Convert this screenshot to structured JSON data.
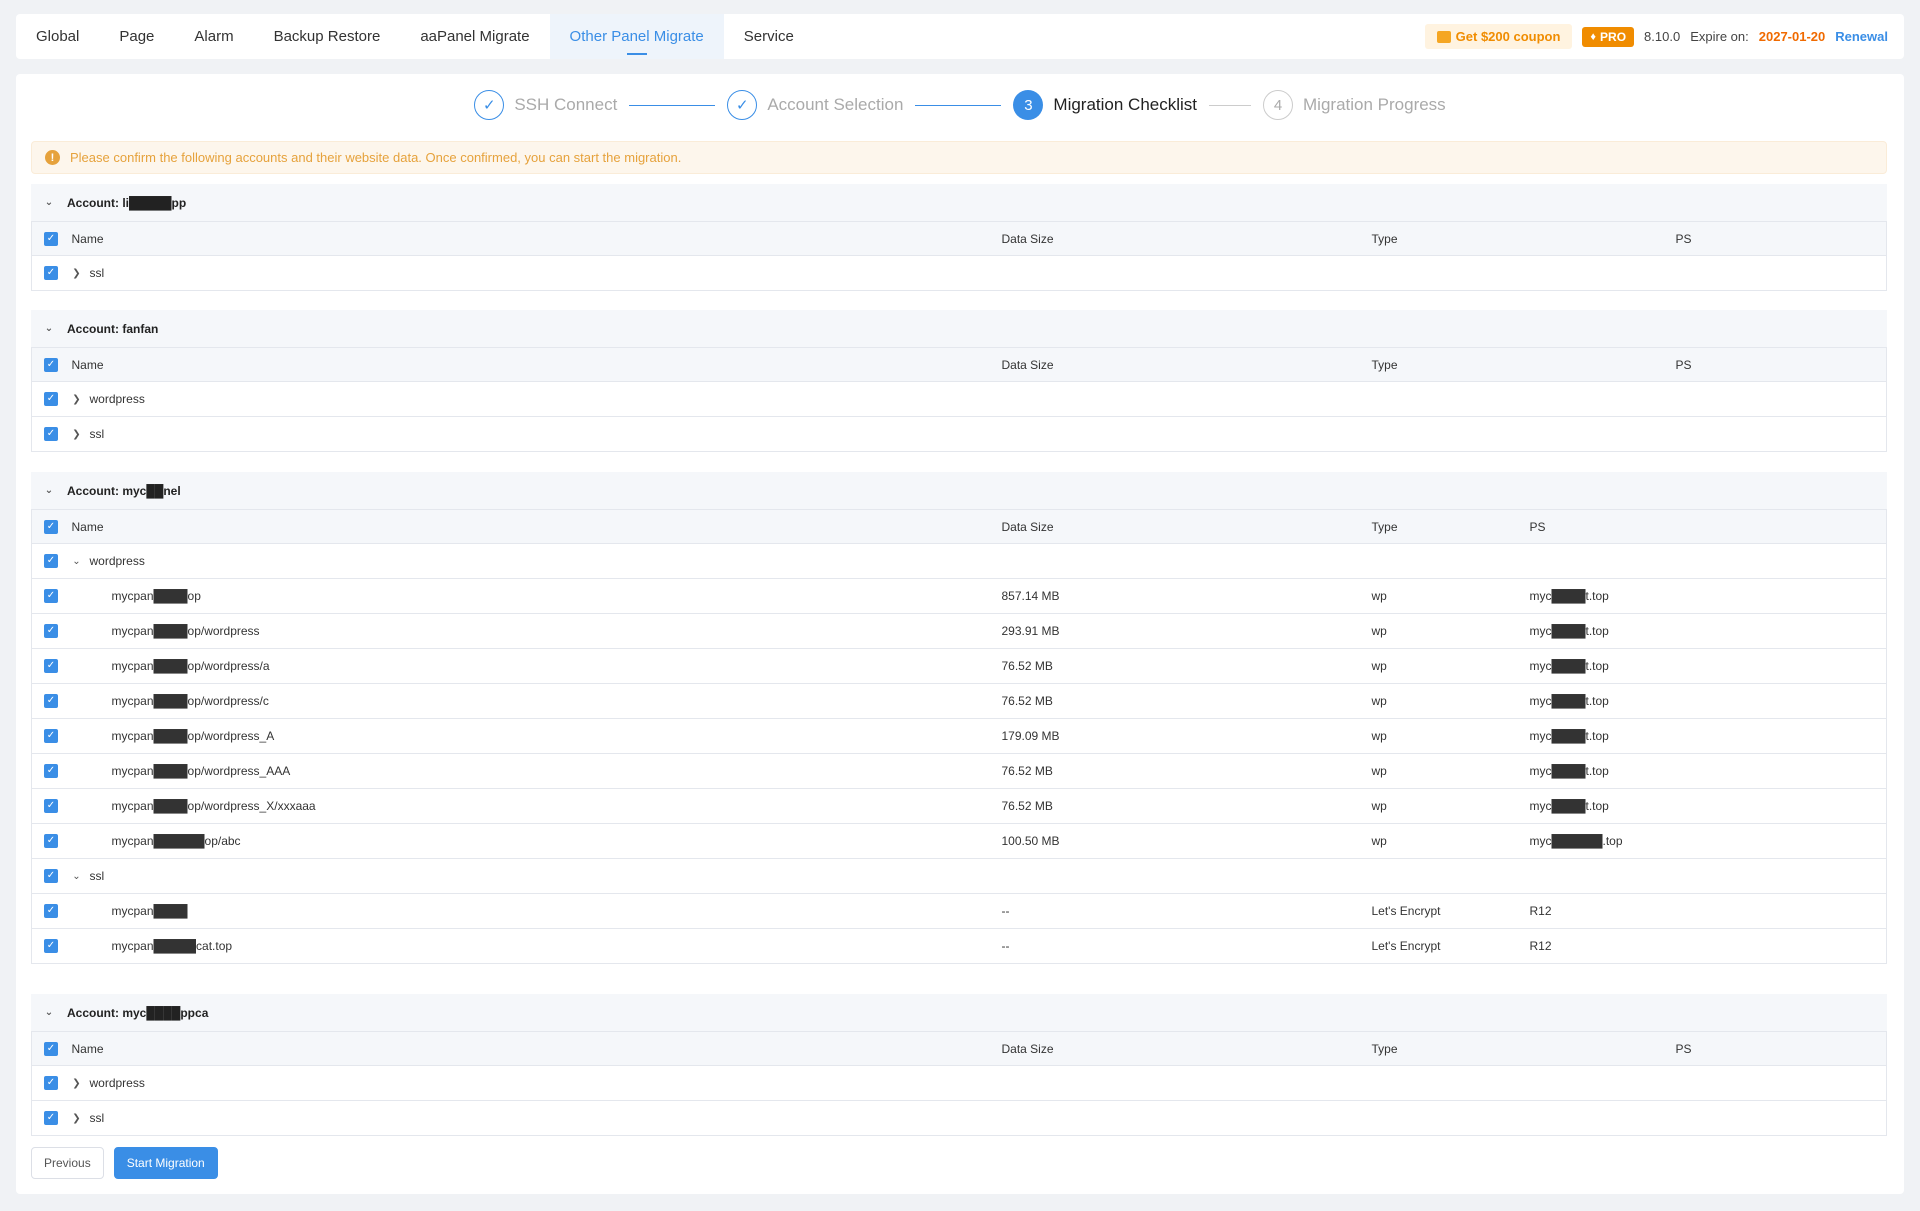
{
  "tabs": [
    "Global",
    "Page",
    "Alarm",
    "Backup Restore",
    "aaPanel Migrate",
    "Other Panel Migrate",
    "Service"
  ],
  "active_tab": "Other Panel Migrate",
  "header": {
    "coupon": "Get $200 coupon",
    "pro": "PRO",
    "version": "8.10.0",
    "expire_label": "Expire on:",
    "expire_date": "2027-01-20",
    "renewal": "Renewal"
  },
  "steps": [
    {
      "num": "1",
      "label": "SSH Connect",
      "state": "done"
    },
    {
      "num": "2",
      "label": "Account Selection",
      "state": "done"
    },
    {
      "num": "3",
      "label": "Migration Checklist",
      "state": "current"
    },
    {
      "num": "4",
      "label": "Migration Progress",
      "state": "pending"
    }
  ],
  "alert": "Please confirm the following accounts and their website data. Once confirmed, you can start the migration.",
  "columns": {
    "name": "Name",
    "size": "Data Size",
    "type": "Type",
    "ps": "PS"
  },
  "accounts": [
    {
      "title": "Account: li█████pp",
      "rows": [
        {
          "name": "ssl",
          "kind": "group-collapsed"
        }
      ]
    },
    {
      "title": "Account: fanfan",
      "rows": [
        {
          "name": "wordpress",
          "kind": "group-collapsed"
        },
        {
          "name": "ssl",
          "kind": "group-collapsed"
        }
      ]
    },
    {
      "title": "Account: myc██nel",
      "rows": [
        {
          "name": "wordpress",
          "kind": "group-expanded"
        },
        {
          "name": "mycpan████op",
          "size": "857.14 MB",
          "type": "wp",
          "ps": "myc████t.top",
          "kind": "child"
        },
        {
          "name": "mycpan████op/wordpress",
          "size": "293.91 MB",
          "type": "wp",
          "ps": "myc████t.top",
          "kind": "child"
        },
        {
          "name": "mycpan████op/wordpress/a",
          "size": "76.52 MB",
          "type": "wp",
          "ps": "myc████t.top",
          "kind": "child"
        },
        {
          "name": "mycpan████op/wordpress/c",
          "size": "76.52 MB",
          "type": "wp",
          "ps": "myc████t.top",
          "kind": "child"
        },
        {
          "name": "mycpan████op/wordpress_A",
          "size": "179.09 MB",
          "type": "wp",
          "ps": "myc████t.top",
          "kind": "child"
        },
        {
          "name": "mycpan████op/wordpress_AAA",
          "size": "76.52 MB",
          "type": "wp",
          "ps": "myc████t.top",
          "kind": "child"
        },
        {
          "name": "mycpan████op/wordpress_X/xxxaaa",
          "size": "76.52 MB",
          "type": "wp",
          "ps": "myc████t.top",
          "kind": "child"
        },
        {
          "name": "mycpan██████op/abc",
          "size": "100.50 MB",
          "type": "wp",
          "ps": "myc██████.top",
          "kind": "child"
        },
        {
          "name": "ssl",
          "kind": "group-expanded"
        },
        {
          "name": "mycpan████",
          "size": "--",
          "type": "Let's Encrypt",
          "ps": "R12",
          "kind": "child"
        },
        {
          "name": "mycpan█████cat.top",
          "size": "--",
          "type": "Let's Encrypt",
          "ps": "R12",
          "kind": "child"
        }
      ]
    },
    {
      "title": "Account: myc████ppca",
      "rows": [
        {
          "name": "wordpress",
          "kind": "group-collapsed"
        },
        {
          "name": "ssl",
          "kind": "group-collapsed"
        }
      ]
    }
  ],
  "buttons": {
    "previous": "Previous",
    "start": "Start Migration"
  },
  "colors": {
    "primary": "#3a8ee6",
    "warning": "#e6a23c",
    "orange": "#f08c00"
  }
}
